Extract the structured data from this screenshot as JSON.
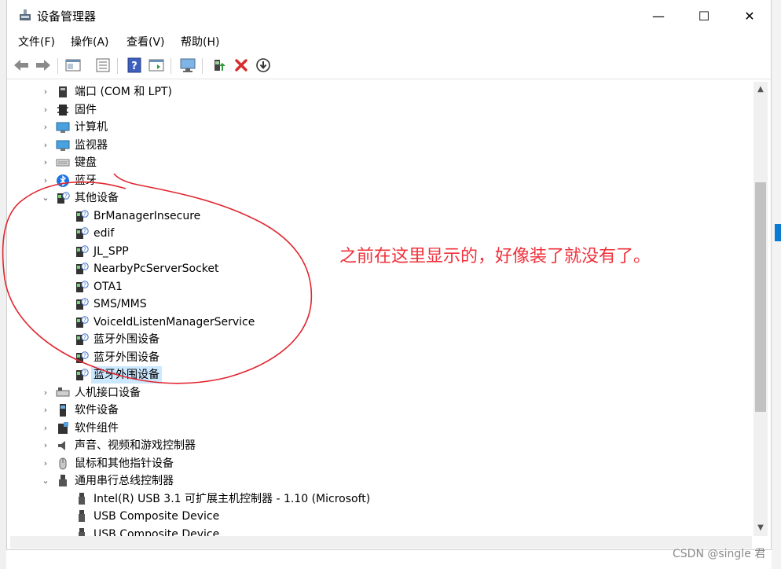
{
  "window": {
    "title": "设备管理器",
    "controls": {
      "minimize": "—",
      "maximize": "☐",
      "close": "✕"
    }
  },
  "menu": [
    "文件(F)",
    "操作(A)",
    "查看(V)",
    "帮助(H)"
  ],
  "toolbar": [
    "back-icon",
    "forward-icon",
    "properties-icon",
    "tree-view-icon",
    "help-icon",
    "action-view-icon",
    "monitor-scan-icon",
    "update-driver-icon",
    "uninstall-icon",
    "disable-icon"
  ],
  "tree": {
    "categories_top": [
      {
        "label": "端口 (COM 和 LPT)",
        "icon": "port-icon",
        "expanded": false
      },
      {
        "label": "固件",
        "icon": "firmware-icon",
        "expanded": false
      },
      {
        "label": "计算机",
        "icon": "computer-icon",
        "expanded": false
      },
      {
        "label": "监视器",
        "icon": "monitor-icon",
        "expanded": false
      },
      {
        "label": "键盘",
        "icon": "keyboard-icon",
        "expanded": false
      },
      {
        "label": "蓝牙",
        "icon": "bluetooth-icon",
        "expanded": false
      }
    ],
    "other_devices": {
      "label": "其他设备",
      "icon": "unknown-device-icon",
      "expanded": true,
      "children": [
        "BrManagerInsecure",
        "edif",
        "JL_SPP",
        "NearbyPcServerSocket",
        "OTA1",
        "SMS/MMS",
        "VoiceIdListenManagerService",
        "蓝牙外围设备",
        "蓝牙外围设备",
        "蓝牙外围设备"
      ],
      "selected_index": 9
    },
    "categories_bottom": [
      {
        "label": "人机接口设备",
        "icon": "hid-icon",
        "expanded": false
      },
      {
        "label": "软件设备",
        "icon": "software-device-icon",
        "expanded": false
      },
      {
        "label": "软件组件",
        "icon": "software-component-icon",
        "expanded": false
      },
      {
        "label": "声音、视频和游戏控制器",
        "icon": "sound-icon",
        "expanded": false
      },
      {
        "label": "鼠标和其他指针设备",
        "icon": "mouse-icon",
        "expanded": false
      }
    ],
    "usb": {
      "label": "通用串行总线控制器",
      "icon": "usb-icon",
      "expanded": true,
      "children": [
        "Intel(R) USB 3.1 可扩展主机控制器 - 1.10 (Microsoft)",
        "USB Composite Device",
        "USB Composite Device"
      ]
    }
  },
  "annotation": "之前在这里显示的，好像装了就没有了。",
  "watermark": "CSDN @single 君",
  "colors": {
    "annotation": "#f0303a",
    "selection": "#cce8ff",
    "accent": "#0a7ad4"
  }
}
